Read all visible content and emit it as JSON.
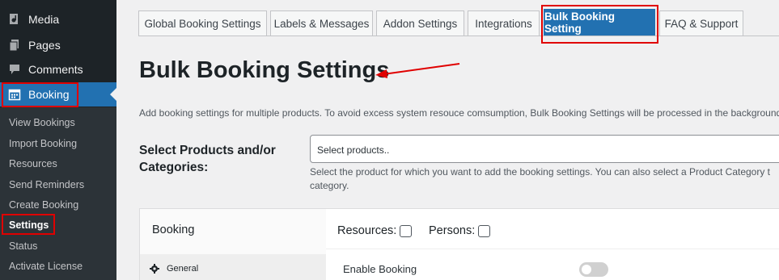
{
  "sidebar": {
    "menu": [
      {
        "label": "Media",
        "icon": "media-icon"
      },
      {
        "label": "Pages",
        "icon": "pages-icon"
      },
      {
        "label": "Comments",
        "icon": "comments-icon"
      },
      {
        "label": "Booking",
        "icon": "calendar-icon"
      }
    ],
    "submenu": [
      {
        "label": "View Bookings"
      },
      {
        "label": "Import Booking"
      },
      {
        "label": "Resources"
      },
      {
        "label": "Send Reminders"
      },
      {
        "label": "Create Booking"
      },
      {
        "label": "Settings"
      },
      {
        "label": "Status"
      },
      {
        "label": "Activate License"
      }
    ]
  },
  "tabs": [
    {
      "label": "Global Booking Settings"
    },
    {
      "label": "Labels & Messages"
    },
    {
      "label": "Addon Settings"
    },
    {
      "label": "Integrations"
    },
    {
      "label": "Bulk Booking Setting"
    },
    {
      "label": "FAQ & Support"
    }
  ],
  "page": {
    "title": "Bulk Booking Settings",
    "description": "Add booking settings for multiple products. To avoid excess system resouce comsumption, Bulk Booking Settings will be processed in the background for",
    "field_label_line1": "Select Products and/or",
    "field_label_line2": "Categories:",
    "select_placeholder": "Select products..",
    "help_line1": "Select the product for which you want to add the booking settings. You can also select a Product Category t",
    "help_line2": "category."
  },
  "panel": {
    "title": "Booking",
    "resources_label": "Resources:",
    "persons_label": "Persons:",
    "general_label": "General",
    "enable_label": "Enable Booking"
  },
  "colors": {
    "accent": "#2271b1",
    "highlight": "#e00000",
    "sidebar_bg": "#1d2327"
  }
}
